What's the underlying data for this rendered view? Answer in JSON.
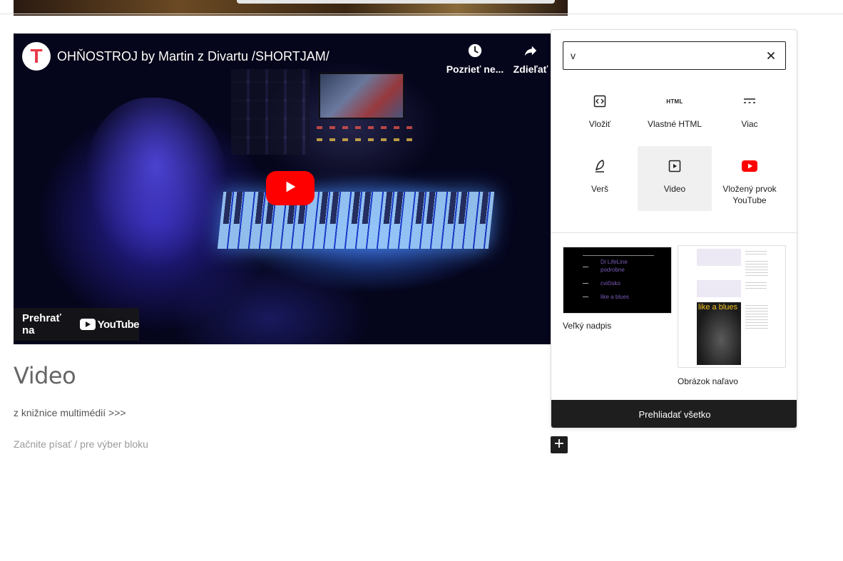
{
  "video_embed": {
    "channel_logo_letter": "T",
    "title": "OHŇOSTROJ by Martin z Divartu /SHORTJAM/",
    "watch_later_label": "Pozrieť ne...",
    "share_label": "Zdieľať",
    "watch_on_label": "Prehrať na",
    "youtube_wordmark": "YouTube"
  },
  "content": {
    "heading": "Video",
    "media_link": "z knižnice multimédií >>>",
    "placeholder": "Začnite písať / pre výber bloku"
  },
  "inserter": {
    "search_value": "v",
    "blocks": [
      {
        "label": "Vložiť",
        "icon": "embed-icon"
      },
      {
        "label": "Vlastné HTML",
        "icon": "html-icon",
        "glyph": "HTML"
      },
      {
        "label": "Viac",
        "icon": "more-icon"
      },
      {
        "label": "Verš",
        "icon": "feather-icon"
      },
      {
        "label": "Video",
        "icon": "video-icon"
      },
      {
        "label": "Vložený prvok YouTube",
        "icon": "youtube-icon"
      }
    ],
    "patterns": [
      {
        "label": "Veľký nadpis",
        "preview_rows": [
          "Di LifeLine",
          "podrobne",
          "cvičisko",
          "like a blues"
        ]
      },
      {
        "label": "Obrázok naľavo",
        "poster_text": "like a blues"
      }
    ],
    "browse_all_label": "Prehliadať všetko"
  },
  "colors": {
    "accent_dark": "#1e1e1e",
    "youtube_red": "#ff0000",
    "channel_logo_red": "#e83a4a"
  }
}
